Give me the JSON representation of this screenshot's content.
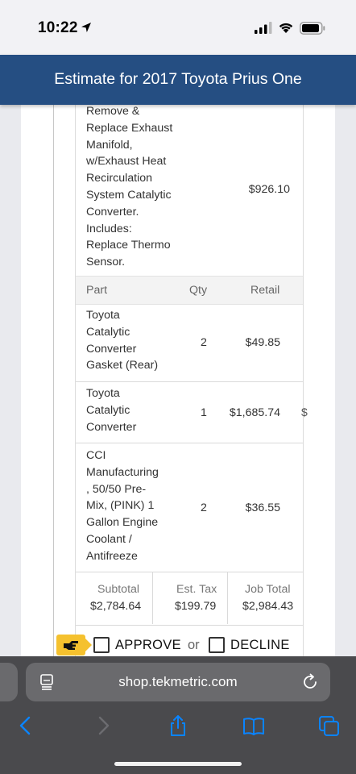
{
  "status_bar": {
    "time": "10:22"
  },
  "app_header": {
    "title": "Estimate for 2017 Toyota Prius One"
  },
  "labor_item": {
    "lines": [
      "Remove &",
      "Replace Exhaust",
      "Manifold,",
      "w/Exhaust Heat",
      "Recirculation",
      "System Catalytic",
      "Converter.",
      "Includes:",
      "Replace Thermo",
      "Sensor."
    ],
    "price": "$926.10"
  },
  "parts_table": {
    "headers": {
      "part": "Part",
      "qty": "Qty",
      "retail": "Retail"
    },
    "rows": [
      {
        "name_lines": [
          "Toyota",
          "Catalytic",
          "Converter",
          "Gasket (Rear)"
        ],
        "qty": "2",
        "retail": "$49.85"
      },
      {
        "name_lines": [
          "Toyota",
          "Catalytic",
          "Converter"
        ],
        "qty": "1",
        "retail": "$1,685.74",
        "overflow": "$"
      },
      {
        "name_lines": [
          "CCI",
          "Manufacturing",
          ", 50/50 Pre-",
          "Mix, (PINK) 1",
          "Gallon Engine",
          "Coolant /",
          "Antifreeze"
        ],
        "qty": "2",
        "retail": "$36.55"
      }
    ]
  },
  "totals": {
    "subtotal_label": "Subtotal",
    "subtotal_value": "$2,784.64",
    "tax_label": "Est. Tax",
    "tax_value": "$199.79",
    "job_total_label": "Job Total",
    "job_total_value": "$2,984.43"
  },
  "actions": {
    "approve_label": "APPROVE",
    "or_label": "or",
    "decline_label": "DECLINE"
  },
  "browser": {
    "url": "shop.tekmetric.com"
  },
  "icons": {
    "status": [
      "location-arrow-icon",
      "cellular-signal-icon",
      "wifi-icon",
      "battery-icon"
    ],
    "browser": [
      "reader-mode-icon",
      "reload-icon",
      "back-icon",
      "forward-icon",
      "share-icon",
      "bookmarks-icon",
      "tabs-icon"
    ],
    "action": "pointing-hand-icon"
  },
  "colors": {
    "header_bg": "#254e82",
    "badge": "#f5c12e",
    "browser_bar": "#4a4a4d",
    "link_blue": "#0a84ff"
  }
}
